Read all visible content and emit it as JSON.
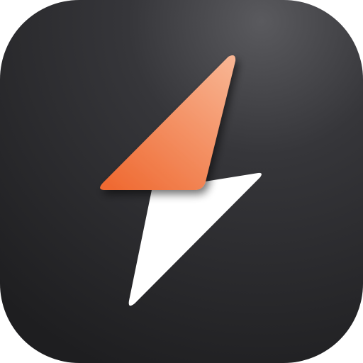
{
  "icon": {
    "name": "lightning-bolt-app-icon",
    "colors": {
      "background_top_right": "#5a5a5e",
      "background_mid": "#36363a",
      "background_bottom_left": "#1e1e20",
      "bolt_top_light": "#f8b593",
      "bolt_top_dark": "#ef6a32",
      "bolt_bottom": "#ffffff"
    }
  }
}
